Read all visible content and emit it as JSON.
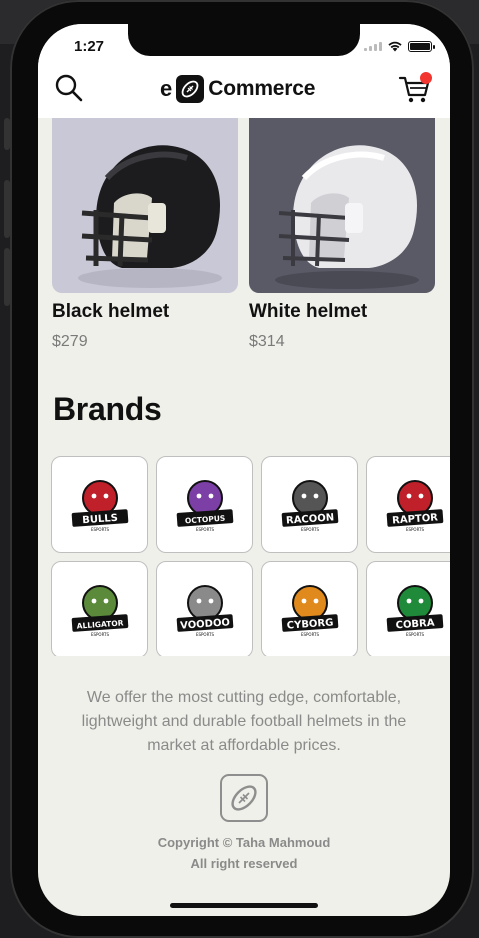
{
  "status": {
    "time": "1:27"
  },
  "header": {
    "logo_prefix": "e",
    "logo_text": "Commerce",
    "cart_badge_color": "#f2362f"
  },
  "products": [
    {
      "name": "Black helmet",
      "price": "$279",
      "bg": "#c9c8d6",
      "shell": "#1c1c1e"
    },
    {
      "name": "White helmet",
      "price": "$314",
      "bg": "#5a5a66",
      "shell": "#e9e9ec"
    }
  ],
  "brands_title": "Brands",
  "brands": [
    {
      "name": "BULLS",
      "sub": "ESPORTS",
      "color": "#c0202a",
      "icon": "bull-logo-icon"
    },
    {
      "name": "OCTOPUS",
      "sub": "ESPORTS",
      "color": "#7b3fa6",
      "icon": "octopus-logo-icon"
    },
    {
      "name": "RACOON",
      "sub": "ESPORTS",
      "color": "#555555",
      "icon": "racoon-logo-icon"
    },
    {
      "name": "RAPTOR",
      "sub": "ESPORTS",
      "color": "#c0202a",
      "icon": "raptor-logo-icon"
    },
    {
      "name": "ALLIGATOR",
      "sub": "ESPORTS",
      "color": "#5b8a3a",
      "icon": "alligator-logo-icon"
    },
    {
      "name": "VOODOO",
      "sub": "ESPORTS",
      "color": "#8a8a8a",
      "icon": "voodoo-logo-icon"
    },
    {
      "name": "CYBORG",
      "sub": "ESPORTS",
      "color": "#e08a1e",
      "icon": "cyborg-logo-icon"
    },
    {
      "name": "COBRA",
      "sub": "ESPORTS",
      "color": "#1f8a3a",
      "icon": "cobra-logo-icon"
    }
  ],
  "about": "We offer the most cutting edge, comfortable, lightweight and durable football helmets in the market at affordable prices.",
  "copyright": {
    "line1": "Copyright © Taha Mahmoud",
    "line2": "All right reserved"
  }
}
